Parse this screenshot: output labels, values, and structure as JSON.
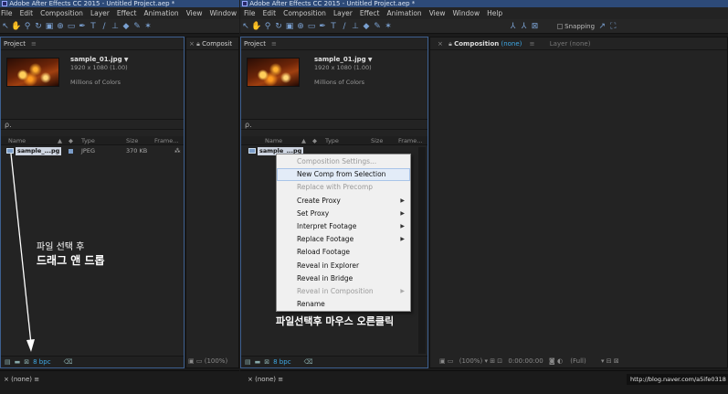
{
  "window": {
    "title_left": "Adobe After Effects CC 2015 - Untitled Project.aep *",
    "title_right": "Adobe After Effects CC 2015 - Untitled Project.aep *"
  },
  "menu_left": [
    "File",
    "Edit",
    "Composition",
    "Layer",
    "Effect",
    "Animation",
    "View",
    "Window",
    "H"
  ],
  "menu_right": [
    "File",
    "Edit",
    "Composition",
    "Layer",
    "Effect",
    "Animation",
    "View",
    "Window",
    "Help"
  ],
  "toolbar": {
    "snapping_label": "Snapping"
  },
  "project_panel": {
    "title": "Project",
    "menu_glyph": "≡",
    "file": {
      "name": "sample_01.jpg",
      "dropdown_glyph": "▼",
      "dimensions": "1920 x 1080 (1.00)",
      "colors": "Millions of Colors"
    },
    "search_glyph": "ρ.",
    "columns": {
      "name": "Name",
      "type": "Type",
      "size": "Size",
      "frame": "Frame..."
    },
    "rows": [
      {
        "name_left": "sample_...pg",
        "name_right": "sample_...pg",
        "type": "JPEG",
        "size": "370 KB"
      }
    ],
    "footer_bpc": "8 bpc"
  },
  "mid_panel_left": {
    "close": "×",
    "title": "Composit"
  },
  "comp_panel": {
    "close": "×",
    "title": "Composition",
    "title_value": "(none)",
    "menu_glyph": "≡",
    "layer_tab": "Layer (none)",
    "footer_zoom": "(100%)",
    "footer_time": "0:00:00:00",
    "footer_res": "(Full)"
  },
  "context_menu": {
    "items": [
      {
        "label": "Composition Settings...",
        "disabled": true,
        "submenu": false
      },
      {
        "label": "New Comp from Selection",
        "disabled": false,
        "submenu": false,
        "highlight": true
      },
      {
        "label": "Replace with Precomp",
        "disabled": true,
        "submenu": false
      },
      {
        "label": "Create Proxy",
        "disabled": false,
        "submenu": true
      },
      {
        "label": "Set Proxy",
        "disabled": false,
        "submenu": true
      },
      {
        "label": "Interpret Footage",
        "disabled": false,
        "submenu": true
      },
      {
        "label": "Replace Footage",
        "disabled": false,
        "submenu": true
      },
      {
        "label": "Reload Footage",
        "disabled": false,
        "submenu": false
      },
      {
        "label": "Reveal in Explorer",
        "disabled": false,
        "submenu": false
      },
      {
        "label": "Reveal in Bridge",
        "disabled": false,
        "submenu": false
      },
      {
        "label": "Reveal in Composition",
        "disabled": true,
        "submenu": true
      },
      {
        "label": "Rename",
        "disabled": false,
        "submenu": false
      }
    ],
    "submenu_glyph": "▶"
  },
  "annotations": {
    "left_line1": "파일 선택 후",
    "left_line2": "드래그 앤 드롭",
    "right": "파일선택후 마우스 오른클릭"
  },
  "bottom": {
    "left_tab": "× (none) ≡",
    "right_tab": "× (none) ≡",
    "watermark": "http://blog.naver.com/a5ife0318"
  },
  "colors": {
    "accent_blue": "#3fa9e6",
    "active_border": "#3d5f8f",
    "annotation": "#ffffff"
  }
}
